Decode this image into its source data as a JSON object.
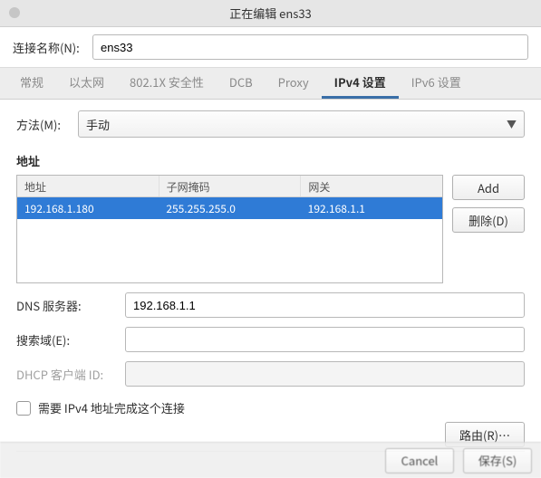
{
  "title": "正在编辑 ens33",
  "conn_name_label": "连接名称(N):",
  "conn_name_value": "ens33",
  "tabs": {
    "general": "常规",
    "ethernet": "以太网",
    "security": "802.1X 安全性",
    "dcb": "DCB",
    "proxy": "Proxy",
    "ipv4": "IPv4 设置",
    "ipv6": "IPv6 设置"
  },
  "method_label": "方法(M):",
  "method_value": "手动",
  "addresses": {
    "heading": "地址",
    "cols": {
      "addr": "地址",
      "mask": "子网掩码",
      "gw": "网关"
    },
    "rows": [
      {
        "addr": "192.168.1.180",
        "mask": "255.255.255.0",
        "gw": "192.168.1.1"
      }
    ],
    "add": "Add",
    "delete": "删除(D)"
  },
  "dns_label": "DNS 服务器:",
  "dns_value": "192.168.1.1",
  "search_label": "搜索域(E):",
  "search_value": "",
  "dhcp_label": "DHCP 客户端 ID:",
  "dhcp_value": "",
  "require_ipv4": "需要 IPv4 地址完成这个连接",
  "route_btn": "路由(R)…",
  "footer": {
    "cancel": "Cancel",
    "save": "保存(S)"
  }
}
